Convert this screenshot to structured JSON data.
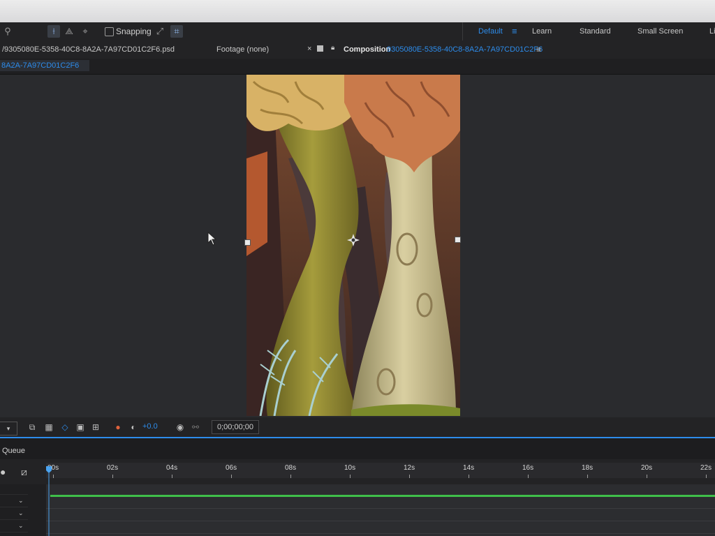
{
  "toolbar": {
    "snapping_label": "Snapping",
    "workspaces": [
      "Default",
      "Learn",
      "Standard",
      "Small Screen",
      "Li"
    ],
    "active_workspace": "Default"
  },
  "tabbar": {
    "project_file": "/9305080E-5358-40C8-8A2A-7A97CD01C2F6.psd",
    "footage_tab": "Footage (none)",
    "close_glyph": "×",
    "composition_label": "Composition",
    "composition_name": "9305080E-5358-40C8-8A2A-7A97CD01C2F6",
    "menu_glyph": "≡"
  },
  "breadcrumb": {
    "label": "8A2A-7A97CD01C2F6"
  },
  "viewer_toolbar": {
    "exposure": "+0.0",
    "timecode": "0;00;00;00"
  },
  "bottom": {
    "queue_tab": "Queue"
  },
  "timeline": {
    "ticks": [
      "00s",
      "02s",
      "04s",
      "06s",
      "08s",
      "10s",
      "12s",
      "14s",
      "16s",
      "18s",
      "20s",
      "22s"
    ]
  },
  "colors": {
    "accent": "#2d8ceb",
    "work_area": "#3fbf4a"
  },
  "icons": [
    "pin-icon",
    "selection-icon",
    "puppet-icon",
    "snap-icon",
    "fast-preview-icon",
    "transparency-grid-icon",
    "mask-icon",
    "region-icon",
    "guides-icon",
    "color-channel-icon",
    "exposure-reset-icon",
    "camera-icon",
    "link-icon"
  ]
}
